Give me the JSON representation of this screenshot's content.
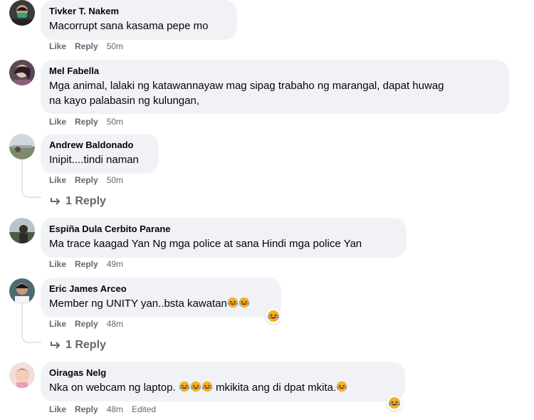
{
  "actions": {
    "like": "Like",
    "reply": "Reply",
    "edited": "Edited"
  },
  "comments": [
    {
      "name": "Tivker T. Nakem",
      "text": "Macorrupt sana kasama pepe mo",
      "time": "50m"
    },
    {
      "name": "Mel Fabella",
      "text_line1": "Mga animal, lalaki ng katawannayaw mag sipag trabaho ng marangal, dapat huwag",
      "text_line2": "na kayo palabasin ng kulungan,",
      "time": "50m"
    },
    {
      "name": "Andrew Baldonado",
      "text": "Inipit....tindi naman",
      "time": "50m",
      "replies": "1 Reply"
    },
    {
      "name": "Espiña Dula Cerbito Parane",
      "text": "Ma trace kaagad Yan Ng mga police at sana Hindi mga police Yan",
      "time": "49m"
    },
    {
      "name": "Eric James Arceo",
      "text": "Member ng UNITY yan..bsta kawatan",
      "time": "48m",
      "replies": "1 Reply"
    },
    {
      "name": "Oiragas Nelg",
      "text_a": "Nka on webcam ng laptop. ",
      "text_b": " mkikita ang di dpat mkita.",
      "time": "48m"
    }
  ],
  "colors": {
    "bubble": "#f0f2f5",
    "meta": "#65676b",
    "emoji": "#f7b125"
  },
  "icons": [
    "reply-arrow-icon",
    "laughing-emoji-icon"
  ]
}
